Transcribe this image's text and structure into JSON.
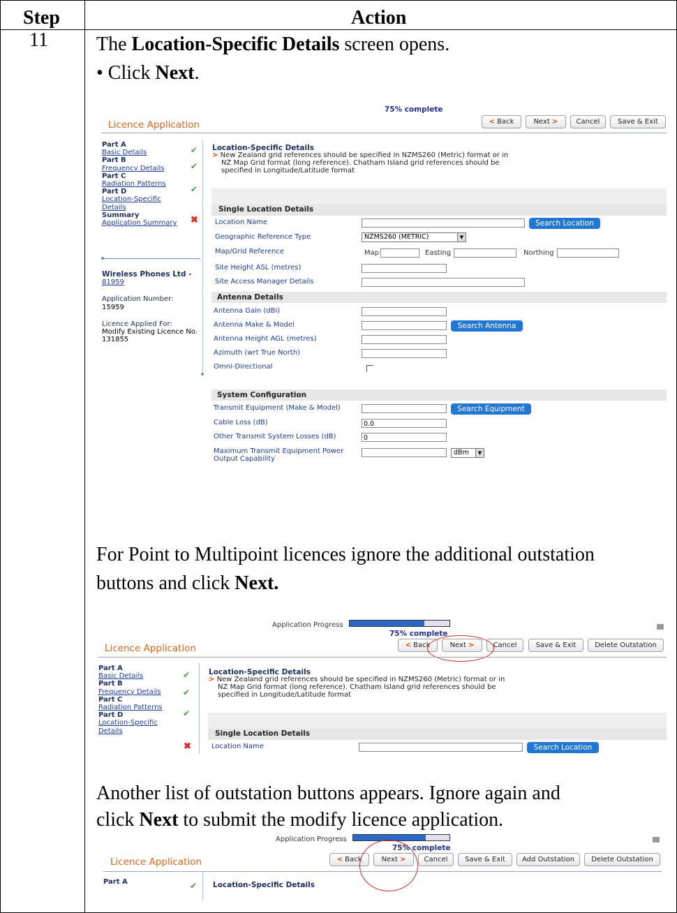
{
  "table": {
    "header_step": "Step",
    "header_action": "Action",
    "step_number": "11"
  },
  "text": {
    "intro_pre": "The ",
    "intro_bold": "Location-Specific Details",
    "intro_post": " screen opens.",
    "bullet_pre": "• Click ",
    "bullet_bold": "Next",
    "bullet_post": ".",
    "p2_line1": "For Point to Multipoint licences ignore the additional outstation",
    "p2_line2_pre": "buttons and click ",
    "p2_line2_bold": "Next.",
    "p3_line1": "Another list of outstation buttons appears.  Ignore again and",
    "p3_line2_pre": "click ",
    "p3_line2_bold": "Next",
    "p3_line2_post": " to submit the modify licence application."
  },
  "app": {
    "title": "Licence Application",
    "progress_label": "Application Progress",
    "progress_text": "75% complete",
    "progress_value": 0.75,
    "buttons": {
      "back": "Back",
      "next": "Next",
      "cancel": "Cancel",
      "save_exit": "Save & Exit",
      "add_outstation": "Add Outstation",
      "delete_outstation": "Delete Outstation",
      "arrow_left": "<",
      "arrow_right": ">"
    },
    "sidebar": {
      "part_a": "Part A",
      "basic_details": "Basic Details",
      "part_b": "Part B",
      "frequency_details": "Frequency Details",
      "part_c": "Part C",
      "radiation_patterns": "Radiation Patterns",
      "part_d": "Part D",
      "location_specific_1": "Location-Specific",
      "location_specific_2": "Details",
      "summary": "Summary",
      "application_summary": "Application Summary",
      "company": "Wireless Phones Ltd -",
      "company_id": "81959",
      "app_number_label": "Application Number:",
      "app_number": "15959",
      "licence_for_label": "Licence Applied For:",
      "licence_for_1": "Modify Existing Licence No.",
      "licence_for_2": "131855"
    },
    "main": {
      "section_title": "Location-Specific Details",
      "note_line1": "New Zealand grid references should be specified in NZMS260 (Metric) format or in",
      "note_line2": "NZ Map Grid format (long reference). Chatham Island grid references should be",
      "note_line3": "specified in Longitude/Latitude format",
      "single_location": "Single Location Details",
      "location_name": "Location Name",
      "search_location": "Search Location",
      "geo_ref_type": "Geographic Reference Type",
      "geo_ref_value": "NZMS260 (METRIC)",
      "map_grid_ref": "Map/Grid Reference",
      "map": "Map",
      "easting": "Easting",
      "northing": "Northing",
      "site_height": "Site Height ASL (metres)",
      "site_access": "Site Access Manager Details",
      "antenna_details": "Antenna Details",
      "antenna_gain": "Antenna Gain (dBi)",
      "antenna_make": "Antenna Make & Model",
      "search_antenna": "Search Antenna",
      "antenna_height": "Antenna Height AGL (metres)",
      "azimuth": "Azimuth (wrt True North)",
      "omni": "Omni-Directional",
      "system_config": "System Configuration",
      "transmit_equipment": "Transmit Equipment (Make & Model)",
      "search_equipment": "Search Equipment",
      "cable_loss": "Cable Loss (dB)",
      "cable_loss_value": "0.0",
      "other_losses": "Other Transmit System Losses (dB)",
      "other_losses_value": "0",
      "max_power_1": "Maximum Transmit Equipment Power",
      "max_power_2": "Output Capability",
      "unit": "dBm"
    }
  }
}
